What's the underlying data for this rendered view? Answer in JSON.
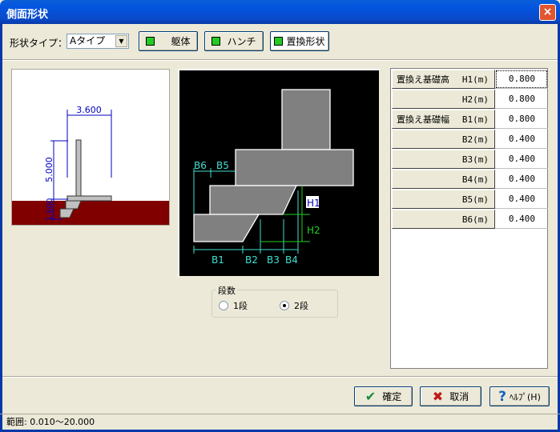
{
  "window": {
    "title": "側面形状",
    "close_icon": "×"
  },
  "toolbar": {
    "shape_type_label": "形状タイプ：",
    "shape_type_value": "Aタイプ",
    "buttons": [
      {
        "label": "躯体"
      },
      {
        "label": "ハンチ"
      },
      {
        "label": "置換形状"
      }
    ]
  },
  "overview": {
    "width_dim": "3.600",
    "height_dim": "5.000",
    "foundation_dim": "1.600",
    "ground_color": "#800000"
  },
  "diagram": {
    "labels": [
      "B6",
      "B5",
      "H1",
      "H2",
      "B1",
      "B2",
      "B3",
      "B4"
    ]
  },
  "steps": {
    "label": "段数",
    "options": [
      {
        "label": "1段",
        "selected": false
      },
      {
        "label": "2段",
        "selected": true
      }
    ]
  },
  "table": {
    "rows": [
      {
        "group": "置換え基礎高",
        "param": "H1(m)",
        "value": "0.800"
      },
      {
        "group": "",
        "param": "H2(m)",
        "value": "0.800"
      },
      {
        "group": "置換え基礎幅",
        "param": "B1(m)",
        "value": "0.800"
      },
      {
        "group": "",
        "param": "B2(m)",
        "value": "0.400"
      },
      {
        "group": "",
        "param": "B3(m)",
        "value": "0.400"
      },
      {
        "group": "",
        "param": "B4(m)",
        "value": "0.400"
      },
      {
        "group": "",
        "param": "B5(m)",
        "value": "0.400"
      },
      {
        "group": "",
        "param": "B6(m)",
        "value": "0.400"
      }
    ]
  },
  "footer": {
    "ok": "確定",
    "cancel": "取消",
    "help": "ﾍﾙﾌﾟ(H)"
  },
  "status": "範囲: 0.010～20.000"
}
